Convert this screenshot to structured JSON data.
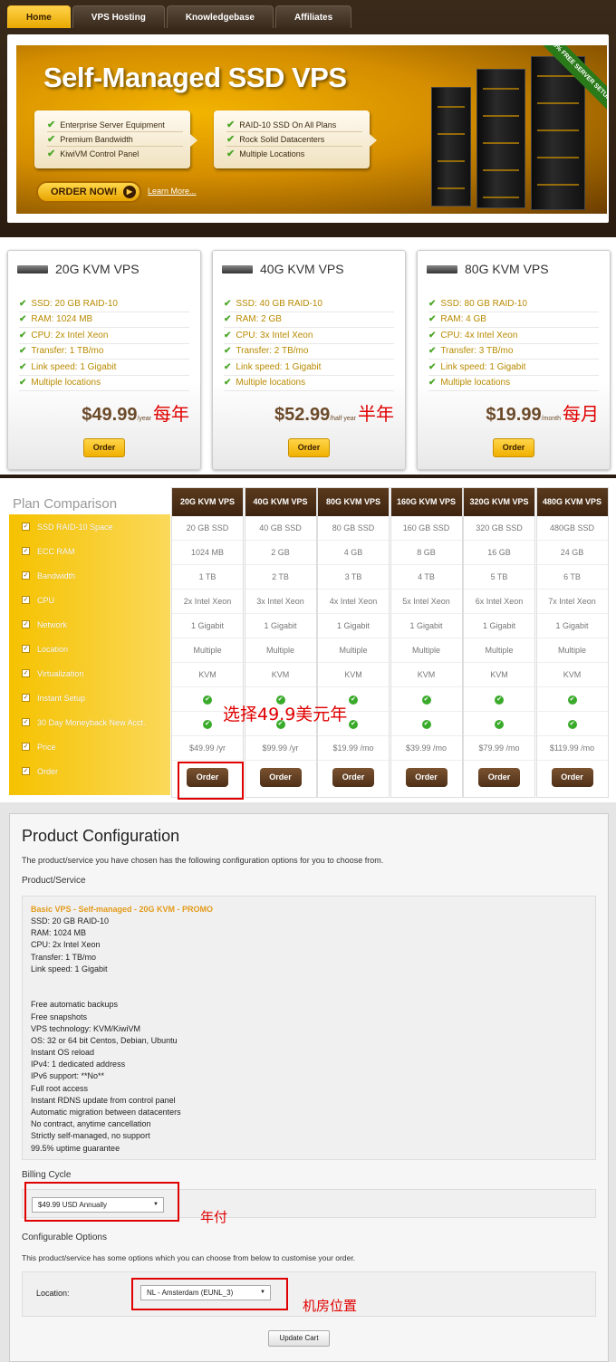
{
  "nav": {
    "tabs": [
      "Home",
      "VPS Hosting",
      "Knowledgebase",
      "Affiliates"
    ]
  },
  "banner": {
    "title": "Self-Managed SSD VPS",
    "features_left": [
      "Enterprise Server Equipment",
      "Premium Bandwidth",
      "KiwiVM Control Panel"
    ],
    "features_right": [
      "RAID-10 SSD On All Plans",
      "Rock Solid Datacenters",
      "Multiple Locations"
    ],
    "order_now": "ORDER NOW!",
    "learn_more": "Learn More...",
    "ribbon": "100% FREE SERVER SETUP"
  },
  "cards": [
    {
      "title": "20G KVM VPS",
      "specs": [
        "SSD: 20 GB RAID-10",
        "RAM: 1024 MB",
        "CPU: 2x Intel Xeon",
        "Transfer: 1 TB/mo",
        "Link speed: 1 Gigabit",
        "Multiple locations"
      ],
      "price": "$49.99",
      "period": "/year",
      "note": "每年",
      "order": "Order"
    },
    {
      "title": "40G KVM VPS",
      "specs": [
        "SSD: 40 GB RAID-10",
        "RAM: 2 GB",
        "CPU: 3x Intel Xeon",
        "Transfer: 2 TB/mo",
        "Link speed: 1 Gigabit",
        "Multiple locations"
      ],
      "price": "$52.99",
      "period": "/half year",
      "note": "半年",
      "order": "Order"
    },
    {
      "title": "80G KVM VPS",
      "specs": [
        "SSD: 80 GB RAID-10",
        "RAM: 4 GB",
        "CPU: 4x Intel Xeon",
        "Transfer: 3 TB/mo",
        "Link speed: 1 Gigabit",
        "Multiple locations"
      ],
      "price": "$19.99",
      "period": "/month",
      "note": "每月",
      "order": "Order"
    }
  ],
  "comparison": {
    "title": "Plan Comparison",
    "features": [
      "SSD RAID-10 Space",
      "ECC RAM",
      "Bandwidth",
      "CPU",
      "Network",
      "Location",
      "Virtualization",
      "Instant Setup",
      "30 Day Moneyback New Acct.",
      "Price",
      "Order"
    ],
    "plans": [
      {
        "name": "20G KVM VPS",
        "cells": [
          "20 GB SSD",
          "1024 MB",
          "1 TB",
          "2x Intel Xeon",
          "1 Gigabit",
          "Multiple",
          "KVM"
        ],
        "price": "$49.99 /yr",
        "order": "Order"
      },
      {
        "name": "40G KVM VPS",
        "cells": [
          "40 GB SSD",
          "2 GB",
          "2 TB",
          "3x Intel Xeon",
          "1 Gigabit",
          "Multiple",
          "KVM"
        ],
        "price": "$99.99 /yr",
        "order": "Order"
      },
      {
        "name": "80G KVM VPS",
        "cells": [
          "80 GB SSD",
          "4 GB",
          "3 TB",
          "4x Intel Xeon",
          "1 Gigabit",
          "Multiple",
          "KVM"
        ],
        "price": "$19.99 /mo",
        "order": "Order"
      },
      {
        "name": "160G KVM VPS",
        "cells": [
          "160 GB SSD",
          "8 GB",
          "4 TB",
          "5x Intel Xeon",
          "1 Gigabit",
          "Multiple",
          "KVM"
        ],
        "price": "$39.99 /mo",
        "order": "Order"
      },
      {
        "name": "320G KVM VPS",
        "cells": [
          "320 GB SSD",
          "16 GB",
          "5 TB",
          "6x Intel Xeon",
          "1 Gigabit",
          "Multiple",
          "KVM"
        ],
        "price": "$79.99 /mo",
        "order": "Order"
      },
      {
        "name": "480G KVM VPS",
        "cells": [
          "480GB SSD",
          "24 GB",
          "6 TB",
          "7x Intel Xeon",
          "1 Gigabit",
          "Multiple",
          "KVM"
        ],
        "price": "$119.99 /mo",
        "order": "Order"
      }
    ],
    "annotation": "选择49.9美元年"
  },
  "config": {
    "title": "Product Configuration",
    "subtitle": "The product/service you have chosen has the following configuration options for you to choose from.",
    "product_heading": "Product/Service",
    "product_name": "Basic VPS - Self-managed - 20G KVM - PROMO",
    "product_lines": [
      "SSD: 20 GB RAID-10",
      "RAM: 1024 MB",
      "CPU: 2x Intel Xeon",
      "Transfer: 1 TB/mo",
      "Link speed: 1 Gigabit",
      "",
      "",
      "Free automatic backups",
      "Free snapshots",
      "VPS technology: KVM/KiwiVM",
      "OS: 32 or 64 bit Centos, Debian, Ubuntu",
      "Instant OS reload",
      "IPv4: 1 dedicated address",
      "IPv6 support: **No**",
      "Full root access",
      "Instant RDNS update from control panel",
      "Automatic migration between datacenters",
      "No contract, anytime cancellation",
      "Strictly self-managed, no support",
      "99.5% uptime guarantee"
    ],
    "billing_heading": "Billing Cycle",
    "billing_value": "$49.99 USD Annually",
    "billing_note": "年付",
    "configurable_heading": "Configurable Options",
    "configurable_sub": "This product/service has some options which you can choose from below to customise your order.",
    "location_label": "Location:",
    "location_value": "NL - Amsterdam (EUNL_3)",
    "location_note": "机房位置",
    "update_cart": "Update Cart"
  }
}
